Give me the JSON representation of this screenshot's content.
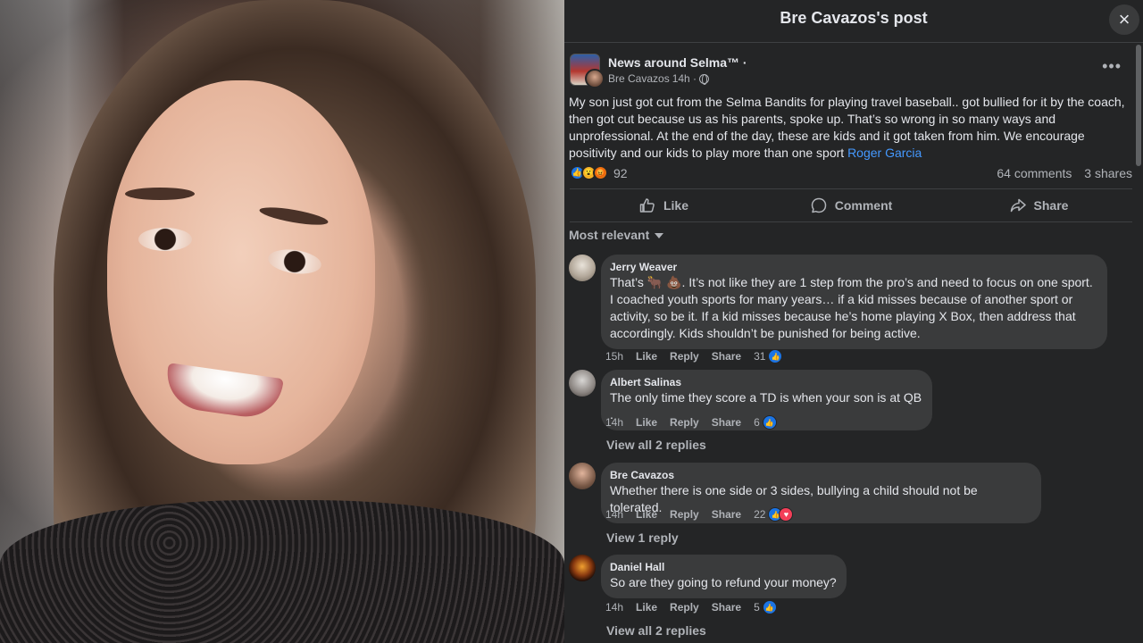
{
  "dialog": {
    "title": "Bre Cavazos's post",
    "close_icon": "×"
  },
  "post": {
    "page_name": "News around Selma™ ·",
    "author": "Bre Cavazos",
    "time": "14h ·",
    "privacy_icon": "globe-icon",
    "more_label": "•••",
    "text": "My son just got cut from the Selma Bandits for playing travel baseball.. got bullied for it by the coach, then got cut because us as his parents, spoke up. That’s so wrong in so many ways and unprofessional. At the end of the day, these are kids and it got taken from him. We encourage positivity and our kids to play more than one sport ",
    "mention": "Roger Garcia",
    "reaction_count": "92",
    "comments_count": "64 comments",
    "shares_count": "3 shares",
    "actions": {
      "like": "Like",
      "comment": "Comment",
      "share": "Share"
    }
  },
  "sort_label": "Most relevant",
  "comments": [
    {
      "name": "Jerry Weaver",
      "text": "That’s 🐂 💩. It’s not like they are 1 step from the pro’s and need to focus on one sport. I coached youth sports for many years… if a kid misses because of another sport or activity, so be it. If a kid misses because he’s home playing X Box, then address that accordingly. Kids shouldn’t be punished for being active.",
      "time": "15h",
      "like": "Like",
      "reply": "Reply",
      "share": "Share",
      "reactions": "31"
    },
    {
      "name": "Albert Salinas",
      "text": "The only time they score a TD is when your son is at QB .",
      "time": "14h",
      "like": "Like",
      "reply": "Reply",
      "share": "Share",
      "reactions": "6",
      "view_replies": "View all 2 replies"
    },
    {
      "name": "Bre Cavazos",
      "text": "Whether there is one side or 3 sides, bullying a child should not be tolerated.",
      "time": "14h",
      "like": "Like",
      "reply": "Reply",
      "share": "Share",
      "reactions": "22",
      "view_replies": "View 1 reply"
    },
    {
      "name": "Daniel Hall",
      "text": "So are they going to refund your money?",
      "time": "14h",
      "like": "Like",
      "reply": "Reply",
      "share": "Share",
      "reactions": "5",
      "view_replies": "View all 2 replies"
    }
  ],
  "colors": {
    "panel_bg": "#242526",
    "bubble_bg": "#3a3b3c",
    "link_blue": "#4599ff",
    "like_blue": "#1b74e4"
  }
}
